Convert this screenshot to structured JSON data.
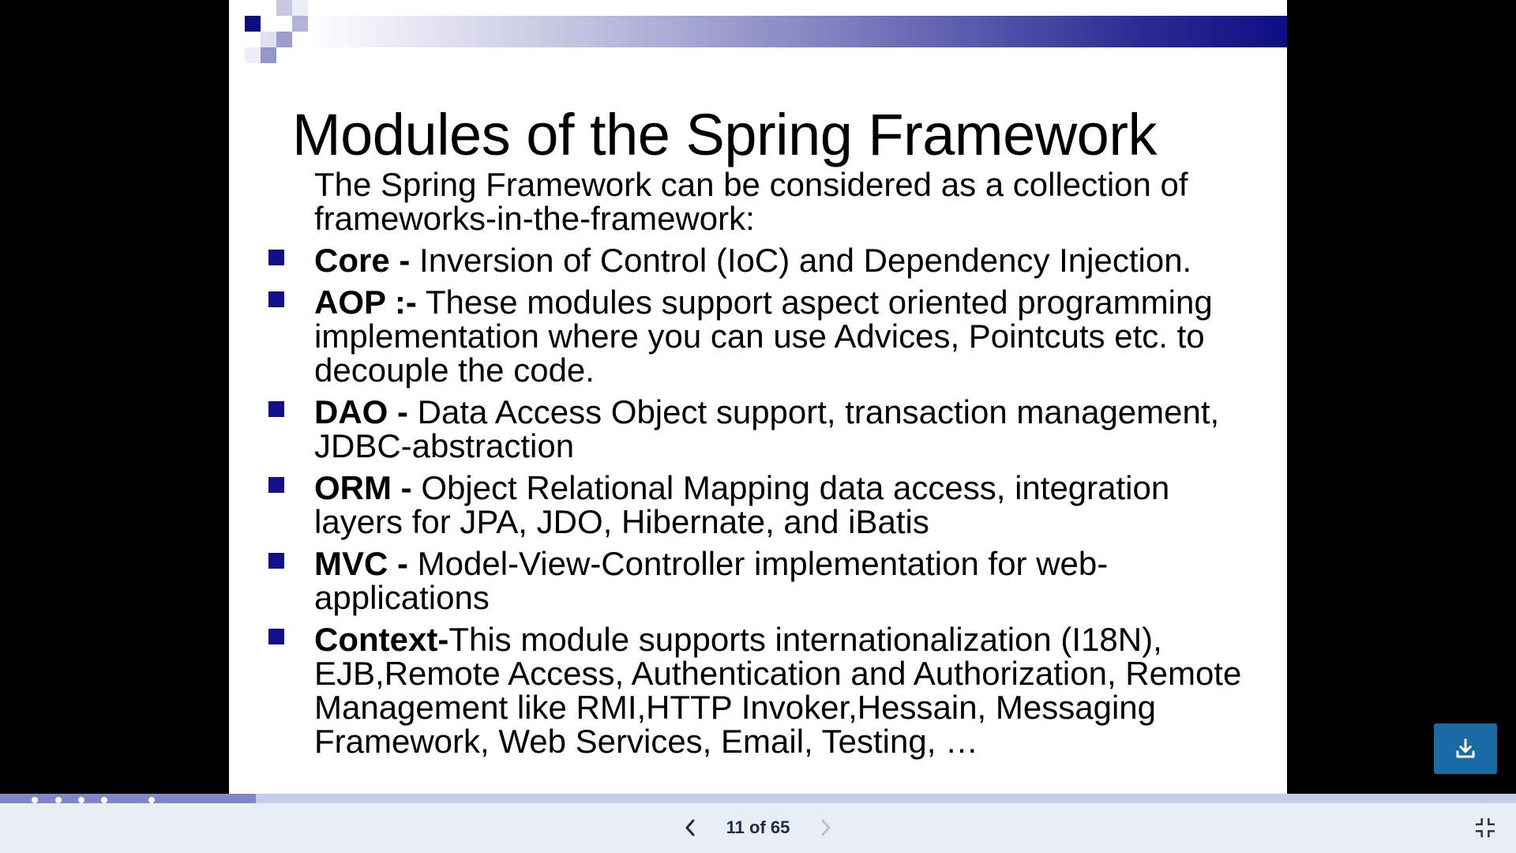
{
  "slide": {
    "title": "Modules of the Spring Framework",
    "intro": "The Spring Framework can be considered as a collection of frameworks-in-the-framework:",
    "items": [
      {
        "term": "Core -",
        "text": " Inversion of Control (IoC) and Dependency Injection."
      },
      {
        "term": "AOP :-",
        "text": " These modules support aspect oriented programming implementation where you can use Advices, Pointcuts etc. to decouple the code."
      },
      {
        "term": "DAO -",
        "text": " Data Access Object support, transaction management, JDBC-abstraction"
      },
      {
        "term": "ORM -",
        "text": " Object Relational Mapping data access, integration layers for JPA, JDO, Hibernate, and iBatis"
      },
      {
        "term": "MVC -",
        "text": " Model-View-Controller implementation for web-applications"
      },
      {
        "term": "Context-",
        "text": "This module supports internationalization (I18N), EJB,Remote Access, Authentication and Authorization, Remote Management like RMI,HTTP Invoker,Hessain, Messaging Framework, Web Services, Email, Testing, …"
      }
    ],
    "bullet_color": "#10108a",
    "band_color": "#0e0e84"
  },
  "viewer": {
    "page_indicator": "11 of 65",
    "current_page": 11,
    "total_pages": 65,
    "progress_fraction": 0.169,
    "prev_icon": "chevron-left-icon",
    "next_icon": "chevron-right-icon",
    "download_icon": "download-icon",
    "exit_fullscreen_icon": "exit-fullscreen-icon",
    "accent_color": "#1a6aa6"
  }
}
